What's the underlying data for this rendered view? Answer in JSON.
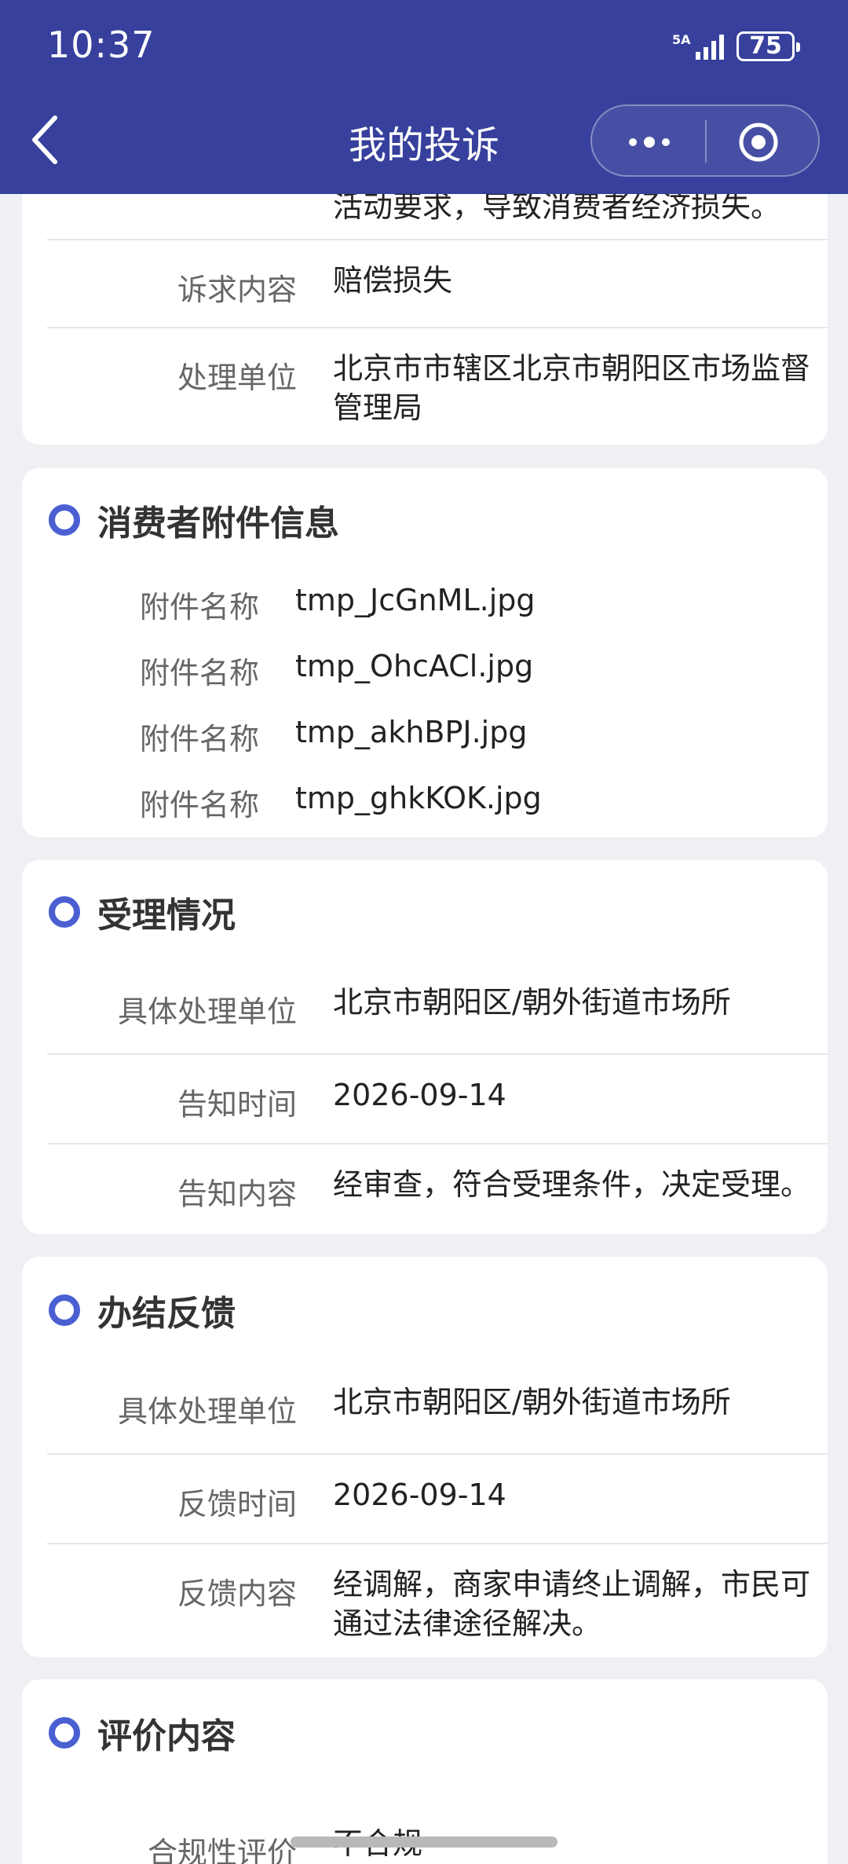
{
  "status": {
    "time": "10:37",
    "network": "5A",
    "battery": "75"
  },
  "nav": {
    "title": "我的投诉"
  },
  "top_card": {
    "cut_text": "活动要求，导致消费者经济损失。",
    "rows": [
      {
        "label": "诉求内容",
        "value": "赔偿损失"
      },
      {
        "label": "处理单位",
        "value": "北京市市辖区北京市朝阳区市场监督管理局"
      }
    ]
  },
  "attachments": {
    "title": "消费者附件信息",
    "items": [
      {
        "label": "附件名称",
        "value": "tmp_JcGnML.jpg"
      },
      {
        "label": "附件名称",
        "value": "tmp_OhcACl.jpg"
      },
      {
        "label": "附件名称",
        "value": "tmp_akhBPJ.jpg"
      },
      {
        "label": "附件名称",
        "value": "tmp_ghkKOK.jpg"
      }
    ]
  },
  "acceptance": {
    "title": "受理情况",
    "rows": [
      {
        "label": "具体处理单位",
        "value": "北京市朝阳区/朝外街道市场所"
      },
      {
        "label": "告知时间",
        "value": "2026-09-14"
      },
      {
        "label": "告知内容",
        "value": "经审查，符合受理条件，决定受理。"
      }
    ]
  },
  "feedback": {
    "title": "办结反馈",
    "rows": [
      {
        "label": "具体处理单位",
        "value": "北京市朝阳区/朝外街道市场所"
      },
      {
        "label": "反馈时间",
        "value": "2026-09-14"
      },
      {
        "label": "反馈内容",
        "value": "经调解，商家申请终止调解，市民可通过法律途径解决。"
      }
    ]
  },
  "evaluation": {
    "title": "评价内容",
    "rows": [
      {
        "label": "合规性评价",
        "value": "不合规"
      }
    ]
  },
  "colors": {
    "nav_bg": "#37409c",
    "accent": "#4a5fd1",
    "page_bg": "#eef0f4"
  }
}
